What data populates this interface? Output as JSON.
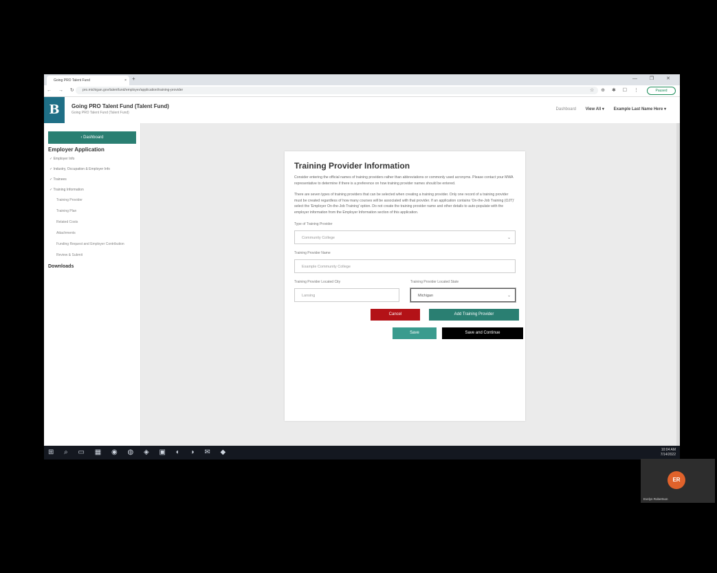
{
  "browser": {
    "tab_title": "Going PRO Talent Fund",
    "tab_close": "×",
    "new_tab": "+",
    "window_controls": "— ❐ ✕",
    "nav_buttons": "← → ↻",
    "url": "pro.michigan.gov/talentfund/employer/application/training-provider",
    "extension_icons": "☆ ⊕ ✱ ☐ ⋮",
    "profile_label": "Paused"
  },
  "app": {
    "logo": "B",
    "title": "Going PRO Talent Fund (Talent Fund)",
    "subtitle": "Going PRO Talent Fund (Talent Fund)",
    "header_links": {
      "dashboard": "Dashboard",
      "help": "View All ▾",
      "user": "Example Last Name Here ▾"
    }
  },
  "sidebar": {
    "dashboard_button": "‹ Dashboard",
    "heading": "Employer Application",
    "items": [
      "✓ Employer Info",
      "✓ Industry, Occupation & Employer Info",
      "✓ Trainees",
      "✓ Training Information"
    ],
    "subitems": [
      "Training Provider",
      "Training Plan",
      "Related Costs",
      "Attachments",
      "Funding Request and Employer Contribution",
      "Review & Submit"
    ],
    "downloads": "Downloads"
  },
  "form": {
    "title": "Training Provider Information",
    "para1": "Consider entering the official names of training providers rather than abbreviations or commonly used acronyms. Please contact your MWA representative to determine if there is a preference on how training provider names should be entered.",
    "para2": "There are seven types of training providers that can be selected when creating a training provider. Only one record of a training provider must be created regardless of how many courses will be associated with that provider. If an application contains 'On-the-Job Training (OJT)' select the 'Employer On-the-Job Training' option. Do not create the training provider name and other details to auto-populate with the employer information from the Employer Information section of this application.",
    "type_label": "Type of Training Provider",
    "type_value": "Community College",
    "name_label": "Training Provider Name",
    "name_placeholder": "Example Community College",
    "city_label": "Training Provider Located City",
    "city_value": "Lansing",
    "state_label": "Training Provider Located State",
    "state_value": "Michigan",
    "chevron": "⌄",
    "cancel": "Cancel",
    "add_provider": "Add Training Provider",
    "save": "Save",
    "save_continue": "Save and Continue"
  },
  "taskbar": {
    "icons": "⊞ ⌕ ▭ ▦ ◉ ◍ ◈ ▣ ◐ ◑ ✉ ◆",
    "time": "10:04 AM",
    "date": "7/14/2022"
  },
  "participant": {
    "initials": "ER",
    "name": "Evelyn Robertson"
  }
}
